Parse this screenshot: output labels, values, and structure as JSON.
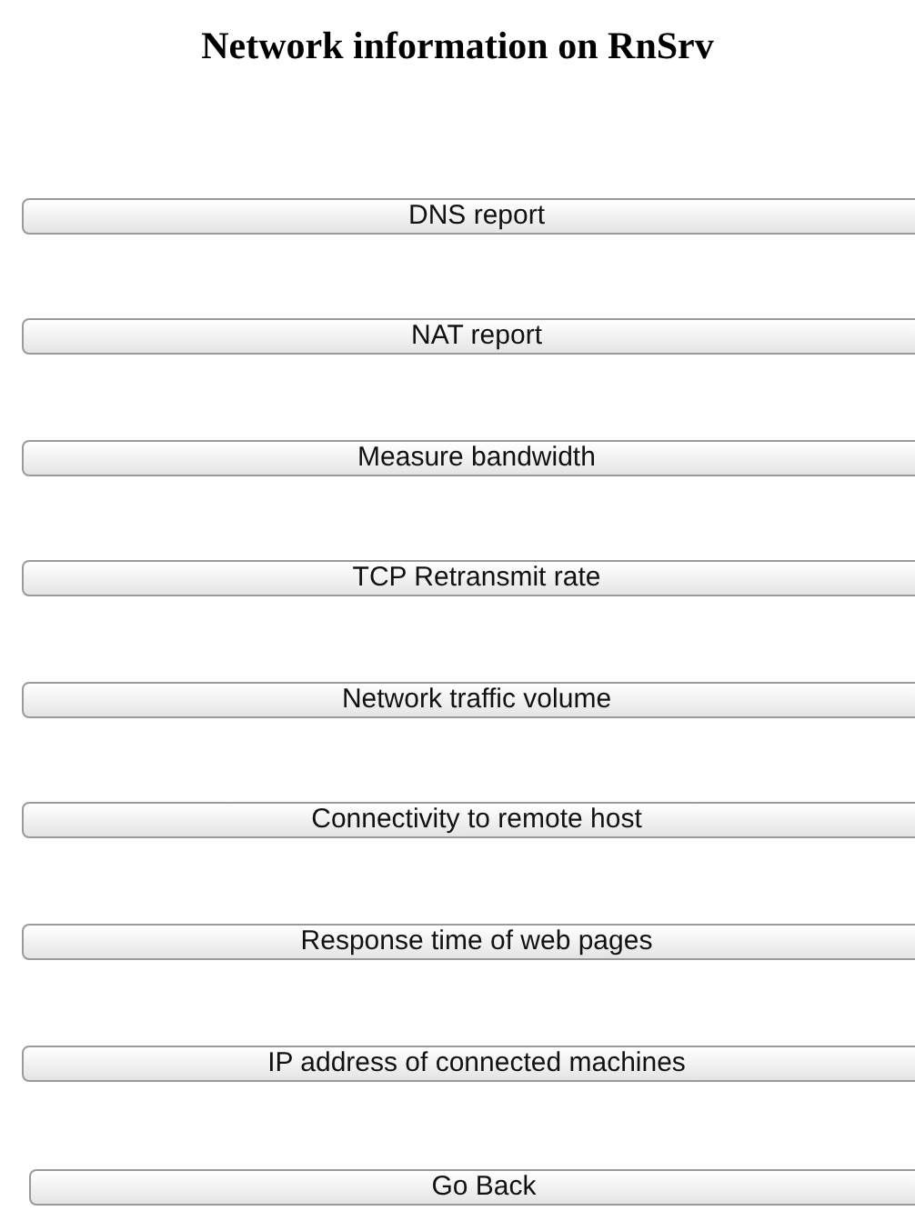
{
  "title": "Network information on RnSrv",
  "buttons": [
    "DNS report",
    "NAT report",
    "Measure bandwidth",
    "TCP Retransmit rate",
    "Network traffic volume",
    "Connectivity to remote host",
    "Response time of web pages",
    "IP address of connected machines"
  ],
  "back_button": "Go Back"
}
